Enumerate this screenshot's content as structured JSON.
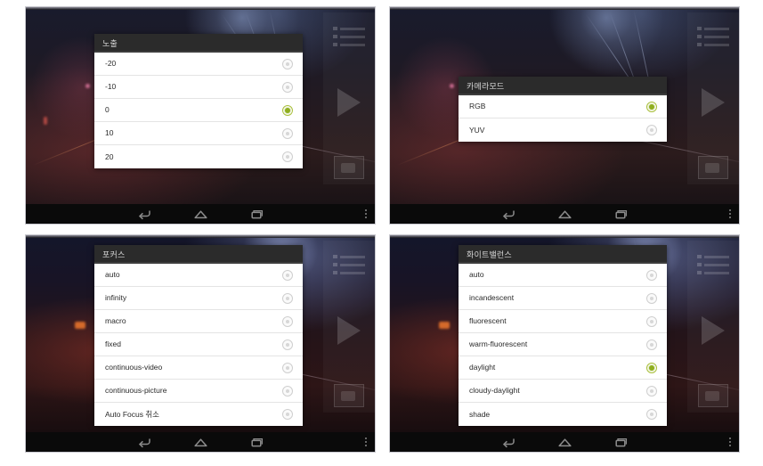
{
  "page": {
    "background_color": "#ffffff",
    "frame_count": 4
  },
  "colors": {
    "dialog_title_bg": "#2b2b2b",
    "dialog_title_text": "#d6d6d6",
    "list_bg": "#ffffff",
    "option_text": "#2a2a2a",
    "radio_selected": "#8fae1f",
    "radio_unselected": "#cfcfcf",
    "navbar_bg": "#0a0a0a",
    "frame_border": "#c9c9cf"
  },
  "navbar": {
    "back_label": "back-button",
    "home_label": "home-button",
    "recents_label": "recent-apps-button",
    "overflow_label": "more-options"
  },
  "camera_rail": {
    "menu_label": "settings-list",
    "play_label": "play",
    "thumbnail_label": "last-capture-thumbnail"
  },
  "panels": [
    {
      "id": "exposure",
      "position": "top-left",
      "dialog": {
        "title": "노출",
        "options": [
          {
            "label": "-20",
            "selected": false
          },
          {
            "label": "-10",
            "selected": false
          },
          {
            "label": "0",
            "selected": true
          },
          {
            "label": "10",
            "selected": false
          },
          {
            "label": "20",
            "selected": false
          }
        ]
      }
    },
    {
      "id": "camera-mode",
      "position": "top-right",
      "dialog": {
        "title": "카메라모드",
        "options": [
          {
            "label": "RGB",
            "selected": true
          },
          {
            "label": "YUV",
            "selected": false
          }
        ]
      }
    },
    {
      "id": "focus",
      "position": "bottom-left",
      "dialog": {
        "title": "포커스",
        "options": [
          {
            "label": "auto",
            "selected": false
          },
          {
            "label": "infinity",
            "selected": false
          },
          {
            "label": "macro",
            "selected": false
          },
          {
            "label": "fixed",
            "selected": false
          },
          {
            "label": "continuous-video",
            "selected": false
          },
          {
            "label": "continuous-picture",
            "selected": false
          },
          {
            "label": "Auto Focus 취소",
            "selected": false
          }
        ]
      }
    },
    {
      "id": "white-balance",
      "position": "bottom-right",
      "dialog": {
        "title": "화이트밸런스",
        "options": [
          {
            "label": "auto",
            "selected": false
          },
          {
            "label": "incandescent",
            "selected": false
          },
          {
            "label": "fluorescent",
            "selected": false
          },
          {
            "label": "warm-fluorescent",
            "selected": false
          },
          {
            "label": "daylight",
            "selected": true
          },
          {
            "label": "cloudy-daylight",
            "selected": false
          },
          {
            "label": "shade",
            "selected": false
          }
        ]
      }
    }
  ]
}
